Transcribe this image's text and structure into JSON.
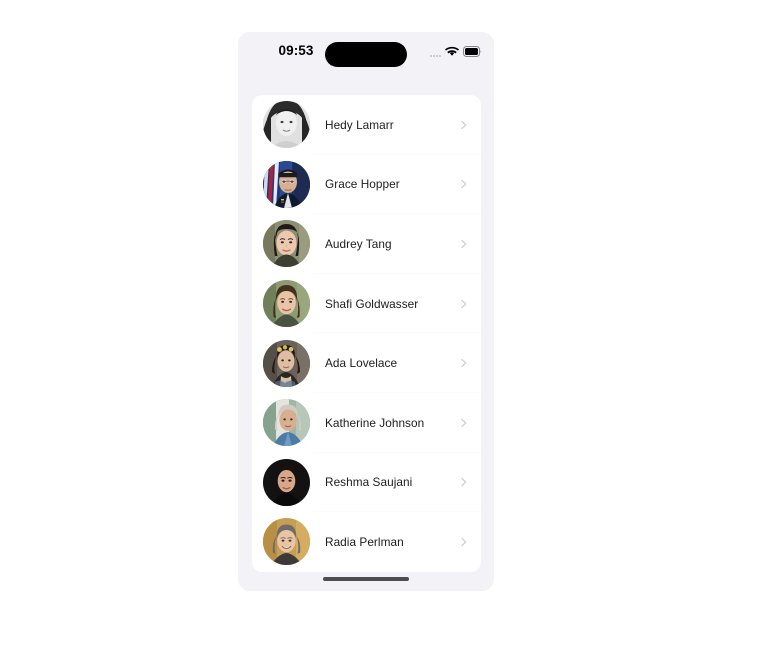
{
  "device": {
    "name": "iphone-mockup",
    "screen_background": "#f2f2f7",
    "page_background": "#ffffff"
  },
  "status_bar": {
    "time": "09:53",
    "cellular_icon": "cellular-signal-icon",
    "wifi_icon": "wifi-icon",
    "battery_icon": "battery-icon",
    "dynamic_island": "dynamic-island"
  },
  "contact_list": {
    "chevron_icon": "chevron-right-icon",
    "items": [
      {
        "name": "Hedy Lamarr",
        "avatar_name": "avatar-hedy-lamarr",
        "avatar_colors": {
          "bg": "#e8e8e8",
          "hair": "#2a2a2a",
          "skin": "#ededed",
          "shade": "#b8b8b8"
        }
      },
      {
        "name": "Grace Hopper",
        "avatar_name": "avatar-grace-hopper",
        "avatar_colors": {
          "bg": "#1d3f8a",
          "hair": "#1b1b1b",
          "skin": "#d8b193",
          "shade": "#b22234"
        }
      },
      {
        "name": "Audrey Tang",
        "avatar_name": "avatar-audrey-tang",
        "avatar_colors": {
          "bg": "#8d8f72",
          "hair": "#1f1a18",
          "skin": "#e8c6ae",
          "shade": "#6e7358"
        }
      },
      {
        "name": "Shafi Goldwasser",
        "avatar_name": "avatar-shafi-goldwasser",
        "avatar_colors": {
          "bg": "#7f8f6a",
          "hair": "#3a2a20",
          "skin": "#e7c3a6",
          "shade": "#5d6b4c"
        }
      },
      {
        "name": "Ada Lovelace",
        "avatar_name": "avatar-ada-lovelace",
        "avatar_colors": {
          "bg": "#6a5f54",
          "hair": "#241a14",
          "skin": "#ddbda4",
          "shade": "#4a4038"
        }
      },
      {
        "name": "Katherine Johnson",
        "avatar_name": "avatar-katherine-johnson",
        "avatar_colors": {
          "bg": "#8fae9c",
          "hair": "#cfc6bd",
          "skin": "#d9b496",
          "shade": "#5f87b3"
        }
      },
      {
        "name": "Reshma Saujani",
        "avatar_name": "avatar-reshma-saujani",
        "avatar_colors": {
          "bg": "#141414",
          "hair": "#1a1412",
          "skin": "#d7a787",
          "shade": "#0c0c0c"
        }
      },
      {
        "name": "Radia Perlman",
        "avatar_name": "avatar-radia-perlman",
        "avatar_colors": {
          "bg": "#c79f54",
          "hair": "#6e6a66",
          "skin": "#e8c3a5",
          "shade": "#a8823f"
        }
      }
    ]
  },
  "home_indicator": {
    "label": "home-indicator"
  }
}
